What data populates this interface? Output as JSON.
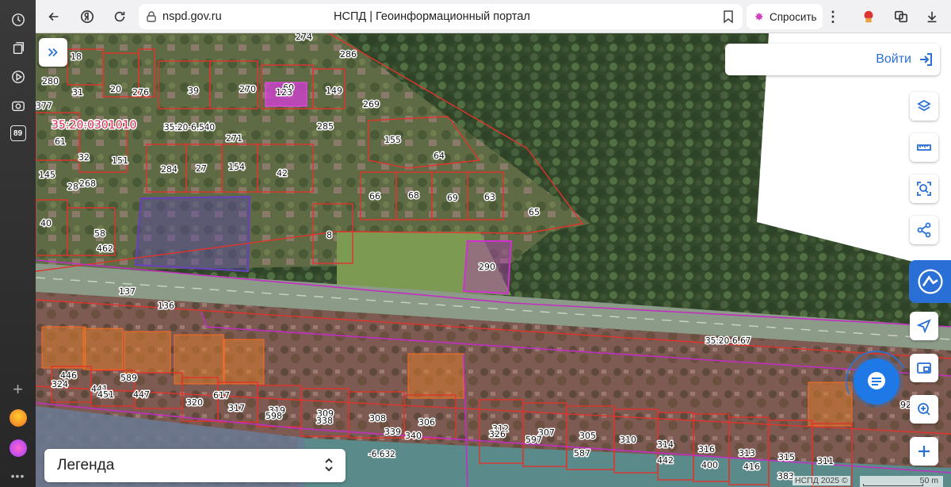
{
  "browser": {
    "url": "nspd.gov.ru",
    "page_title": "НСПД | Геоинформационный портал",
    "ask_label": "Спросить",
    "sidebar_badge": "89"
  },
  "map": {
    "login_label": "Войти",
    "legend_label": "Легенда",
    "copyright": "НСПД 2025 ©",
    "scale_label": "50 m",
    "quarter_label": "35:20:0301010",
    "road_labels": [
      "35:20-6.540",
      "35:20-6.67",
      "-6.632"
    ],
    "parcel_labels": [
      {
        "t": "18"
      },
      {
        "t": "274"
      },
      {
        "t": "286"
      },
      {
        "t": "280"
      },
      {
        "t": "20"
      },
      {
        "t": "276"
      },
      {
        "t": "31"
      },
      {
        "t": "39"
      },
      {
        "t": "270"
      },
      {
        "t": "60"
      },
      {
        "t": "123"
      },
      {
        "t": "149"
      },
      {
        "t": "377"
      },
      {
        "t": "269"
      },
      {
        "t": "285"
      },
      {
        "t": "61"
      },
      {
        "t": "271"
      },
      {
        "t": "155"
      },
      {
        "t": "32"
      },
      {
        "t": "151"
      },
      {
        "t": "284"
      },
      {
        "t": "27"
      },
      {
        "t": "154"
      },
      {
        "t": "42"
      },
      {
        "t": "64"
      },
      {
        "t": "145"
      },
      {
        "t": "268"
      },
      {
        "t": "28"
      },
      {
        "t": "66"
      },
      {
        "t": "68"
      },
      {
        "t": "69"
      },
      {
        "t": "63"
      },
      {
        "t": "65"
      },
      {
        "t": "40"
      },
      {
        "t": "58"
      },
      {
        "t": "8"
      },
      {
        "t": "462"
      },
      {
        "t": "290"
      },
      {
        "t": "137"
      },
      {
        "t": "136"
      },
      {
        "t": "446"
      },
      {
        "t": "324"
      },
      {
        "t": "589"
      },
      {
        "t": "441"
      },
      {
        "t": "451"
      },
      {
        "t": "447"
      },
      {
        "t": "617"
      },
      {
        "t": "320"
      },
      {
        "t": "317"
      },
      {
        "t": "319"
      },
      {
        "t": "598"
      },
      {
        "t": "309"
      },
      {
        "t": "338"
      },
      {
        "t": "308"
      },
      {
        "t": "306"
      },
      {
        "t": "339"
      },
      {
        "t": "340"
      },
      {
        "t": "312"
      },
      {
        "t": "326"
      },
      {
        "t": "307"
      },
      {
        "t": "597"
      },
      {
        "t": "305"
      },
      {
        "t": "587"
      },
      {
        "t": "310"
      },
      {
        "t": "314"
      },
      {
        "t": "442"
      },
      {
        "t": "316"
      },
      {
        "t": "400"
      },
      {
        "t": "313"
      },
      {
        "t": "416"
      },
      {
        "t": "315"
      },
      {
        "t": "383"
      },
      {
        "t": "311"
      },
      {
        "t": "92"
      }
    ]
  }
}
